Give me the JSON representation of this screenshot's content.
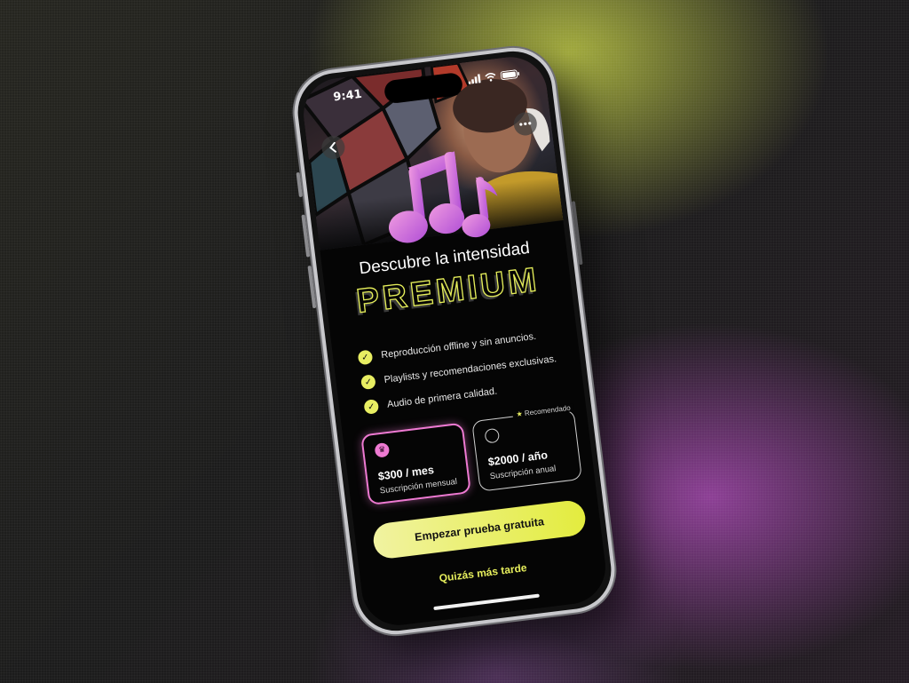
{
  "status_bar": {
    "time": "9:41"
  },
  "header": {
    "back_icon": "chevron-left-icon",
    "more_icon": "ellipsis-icon",
    "hero_graphic": "music-notes-icon"
  },
  "title": {
    "line1": "Descubre la intensidad",
    "line2": "PREMIUM"
  },
  "features": [
    {
      "text": "Reproducción offline y sin anuncios."
    },
    {
      "text": "Playlists y recomendaciones exclusivas."
    },
    {
      "text": "Audio de primera calidad."
    }
  ],
  "plans": {
    "monthly": {
      "price": "$300 / mes",
      "period": "Suscripción mensual",
      "selected": true,
      "icon": "crown-icon"
    },
    "annual": {
      "price": "$2000 / año",
      "period": "Suscripción anual",
      "selected": false,
      "badge": "Recomendado",
      "badge_icon": "star-icon"
    }
  },
  "cta": {
    "label": "Empezar prueba gratuita"
  },
  "secondary": {
    "label": "Quizás más tarde"
  },
  "colors": {
    "accent_yellow": "#e6ee5c",
    "accent_pink": "#ee7ad2",
    "background": "#050505"
  }
}
